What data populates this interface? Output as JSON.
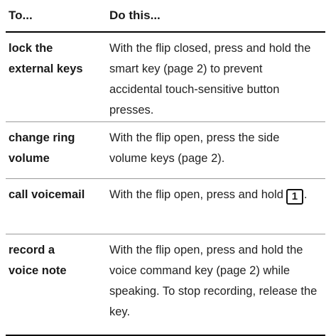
{
  "table": {
    "headers": {
      "col1": "To...",
      "col2": "Do this..."
    },
    "rows": [
      {
        "action_line1": "lock the",
        "action_line2": "external keys",
        "instruction": "With the flip closed, press and hold the smart key (page 2) to prevent accidental touch-sensitive button presses."
      },
      {
        "action_line1": "change ring",
        "action_line2": "volume",
        "instruction": "With the flip open, press the side volume keys (page 2)."
      },
      {
        "action": "call voicemail",
        "instruction_part1": "With the flip open, press and hold",
        "key_label": "1",
        "instruction_part2": "."
      },
      {
        "action_line1": "record a",
        "action_line2": "voice note",
        "instruction": "With the flip open, press and hold the voice command key (page 2) while speaking. To stop recording, release the key."
      }
    ]
  }
}
